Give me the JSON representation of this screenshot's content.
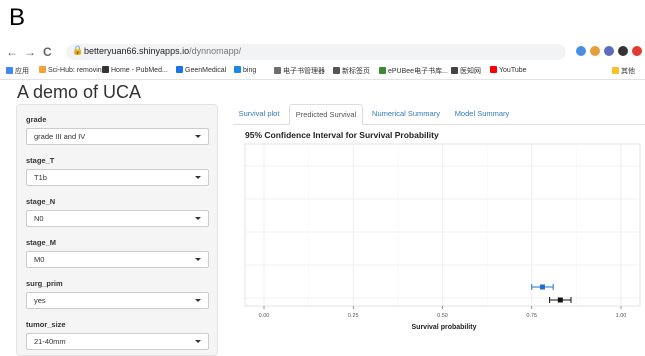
{
  "figure_label": "B",
  "browser": {
    "nav": {
      "back": "←",
      "forward": "→",
      "reload": "C"
    },
    "url_host": "betteryuan66.shinyapps.io",
    "url_path": "/dynnomapp/",
    "bookmarks": [
      "应用",
      "Sci-Hub: removin...",
      "Home - PubMed...",
      "GeenMedical",
      "bing",
      "电子书管理器",
      "新标签页",
      "ePUBee电子书库...",
      "医知网",
      "YouTube",
      "其他"
    ],
    "bookmark_colors": [
      "#4285f4",
      "#f4a236",
      "#333333",
      "#1a73e8",
      "#1e88e5",
      "#6d6d6d",
      "#555555",
      "#3c8d2f",
      "#444444",
      "#ff0000",
      "#f6c026"
    ]
  },
  "app": {
    "title": "A demo of UCA",
    "fields": [
      {
        "label": "grade",
        "value": "grade III and IV"
      },
      {
        "label": "stage_T",
        "value": "T1b"
      },
      {
        "label": "stage_N",
        "value": "N0"
      },
      {
        "label": "stage_M",
        "value": "M0"
      },
      {
        "label": "surg_prim",
        "value": "yes"
      },
      {
        "label": "tumor_size",
        "value": "21-40mm"
      }
    ],
    "tabs": [
      "Survival plot",
      "Predicted Survival",
      "Numerical Summary",
      "Model Summary"
    ],
    "active_tab": "Predicted Survival"
  },
  "chart_data": {
    "type": "scatter",
    "title": "95% Confidence Interval for Survival Probability",
    "xlabel": "Survival probability",
    "ylabel": "",
    "xlim": [
      0,
      1
    ],
    "xticks": [
      "0.00",
      "0.25",
      "0.50",
      "0.75",
      "1.00"
    ],
    "points": [
      {
        "x": 0.78,
        "lower": 0.75,
        "upper": 0.81,
        "color": "#1f6fd1"
      },
      {
        "x": 0.83,
        "lower": 0.8,
        "upper": 0.86,
        "color": "#111111"
      }
    ],
    "grid": true
  }
}
